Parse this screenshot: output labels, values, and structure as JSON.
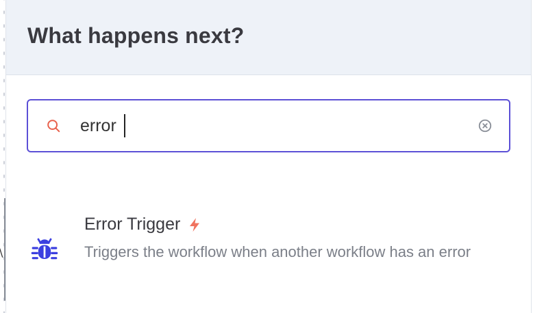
{
  "panel": {
    "title": "What happens next?"
  },
  "search": {
    "value": "error",
    "icon": "search-icon",
    "clear_icon": "clear-circle-icon"
  },
  "results": [
    {
      "title": "Error Trigger",
      "description": "Triggers the workflow when another workflow has an error",
      "icon": "bug-icon",
      "badge_icon": "lightning-bolt-icon"
    }
  ],
  "colors": {
    "accent": "#5b4fd6",
    "header_bg": "#eef2f8",
    "node_icon": "#3b3fe0",
    "trigger_badge": "#f0735f",
    "search_icon": "#e8614c"
  }
}
